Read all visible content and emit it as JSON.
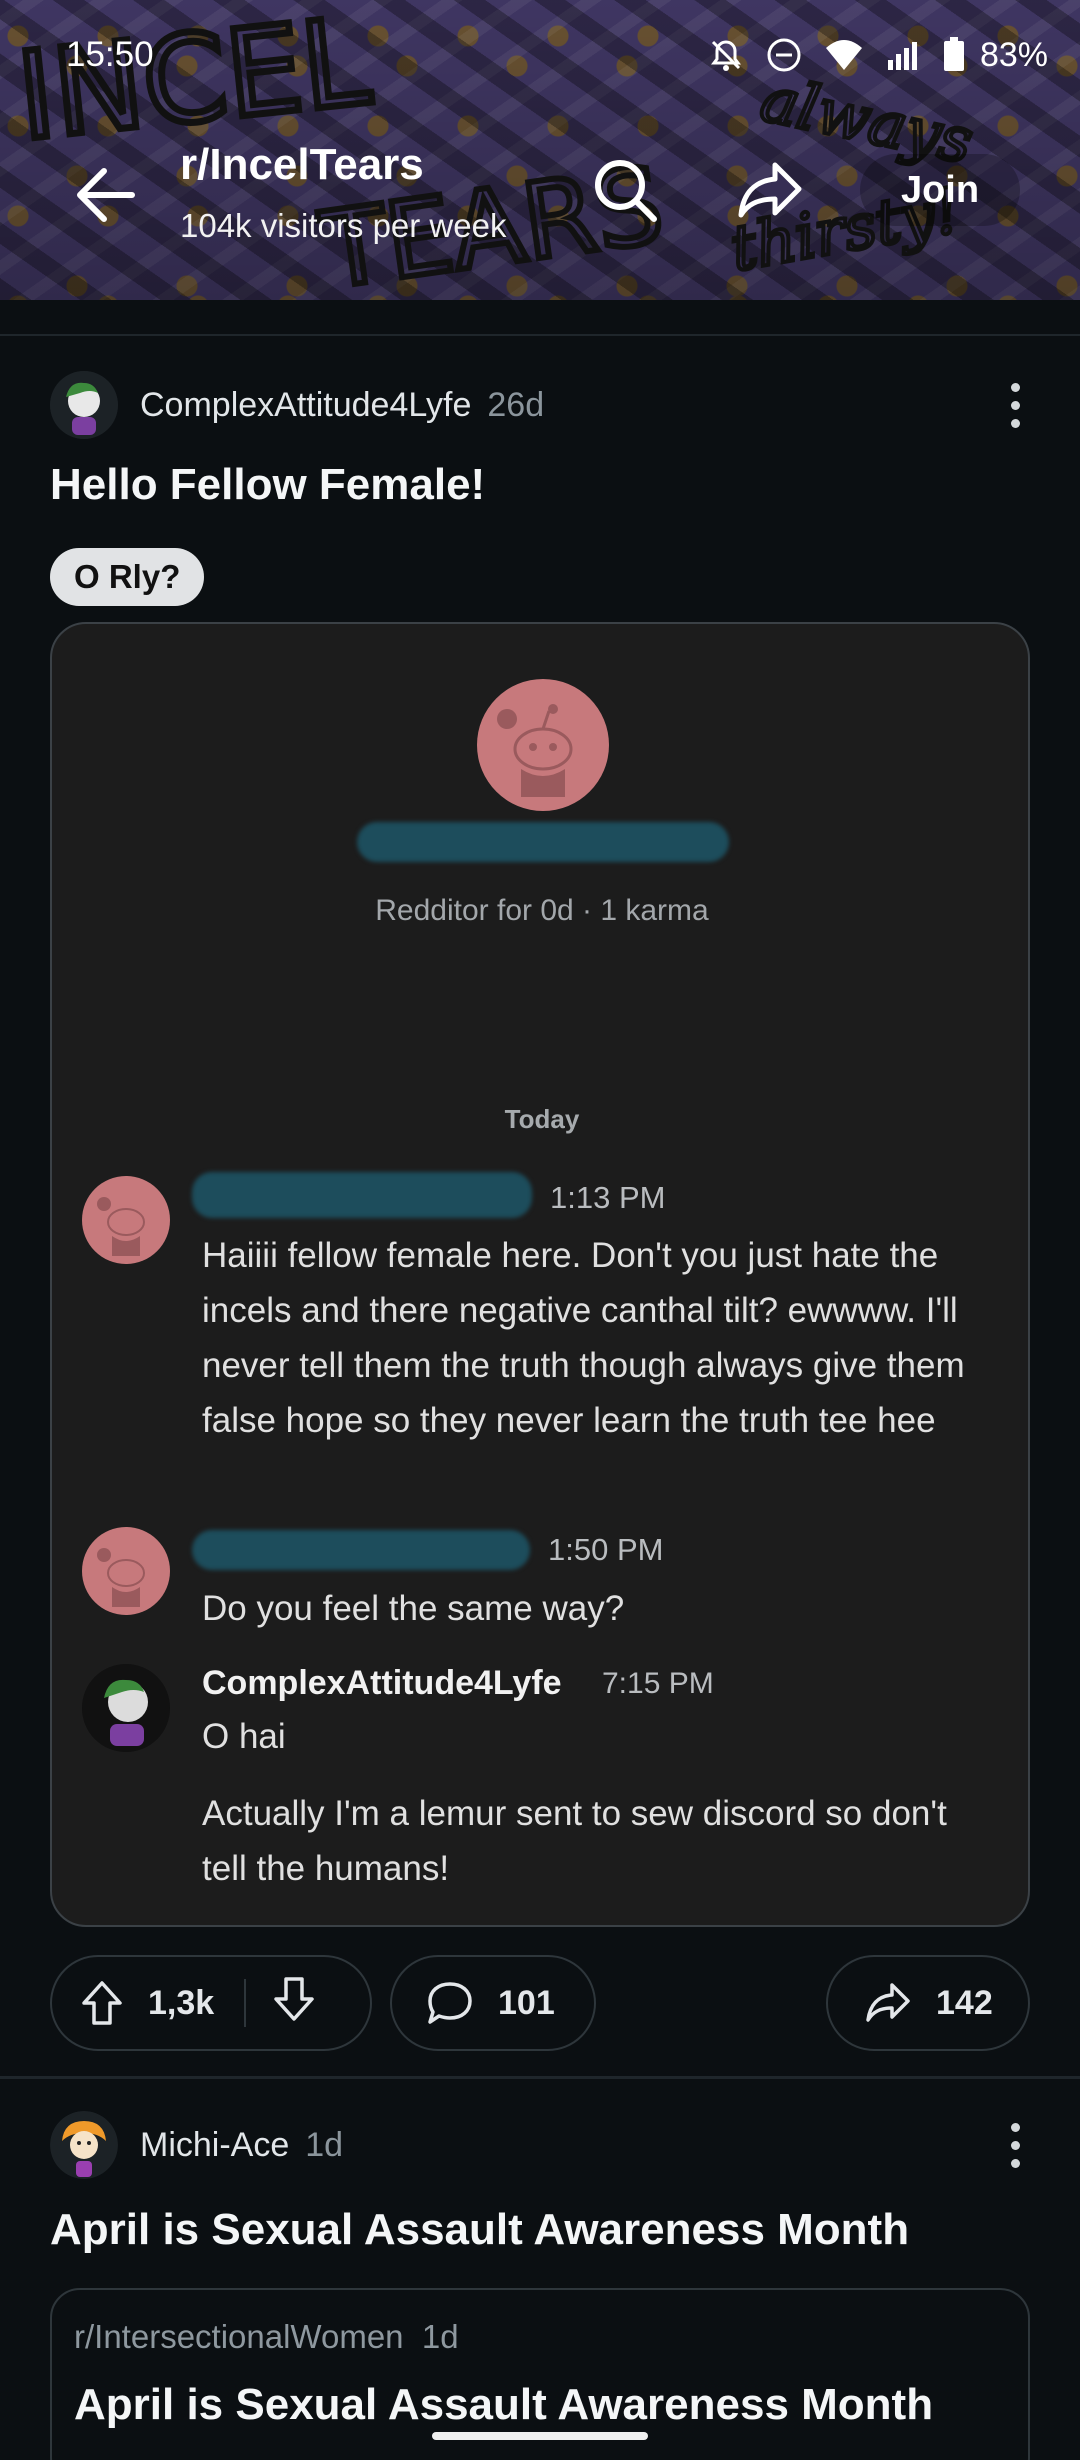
{
  "status_bar": {
    "time": "15:50",
    "battery": "83%"
  },
  "banner": {
    "art_text_1": "INCEL",
    "art_text_2": "TEARS",
    "art_text_3": "always",
    "art_text_4": "thirsty!"
  },
  "header": {
    "subreddit": "r/IncelTears",
    "visitors": "104k visitors per week",
    "join_label": "Join"
  },
  "post": {
    "author": "ComplexAttitude4Lyfe",
    "age": "26d",
    "title": "Hello Fellow Female!",
    "flair": "O Rly?",
    "screenshot": {
      "profile_info": "Redditor for 0d · 1 karma",
      "day": "Today",
      "messages": [
        {
          "time": "1:13 PM",
          "text": "Haiiii fellow female here. Don't you just hate the incels and there negative canthal tilt? ewwww. I'll never tell them the truth though always give them false hope so they never learn the truth tee hee"
        },
        {
          "time": "1:50 PM",
          "text": "Do you feel the same way?"
        },
        {
          "name": "ComplexAttitude4Lyfe",
          "time": "7:15 PM",
          "text": "O hai",
          "text2": "Actually I'm a lemur sent to sew discord so don't tell the humans!"
        }
      ]
    },
    "votes": "1,3k",
    "comments": "101",
    "shares": "142"
  },
  "post2": {
    "author": "Michi-Ace",
    "age": "1d",
    "title": "April is Sexual Assault Awareness Month",
    "crosspost": {
      "subreddit": "r/IntersectionalWomen",
      "age": "1d",
      "title": "April is Sexual Assault Awareness Month"
    }
  },
  "colors": {
    "background": "#0b0f12",
    "banner": "#4a3f73",
    "snoo_avatar": "#c7797c",
    "redaction": "#1d4d5c"
  }
}
